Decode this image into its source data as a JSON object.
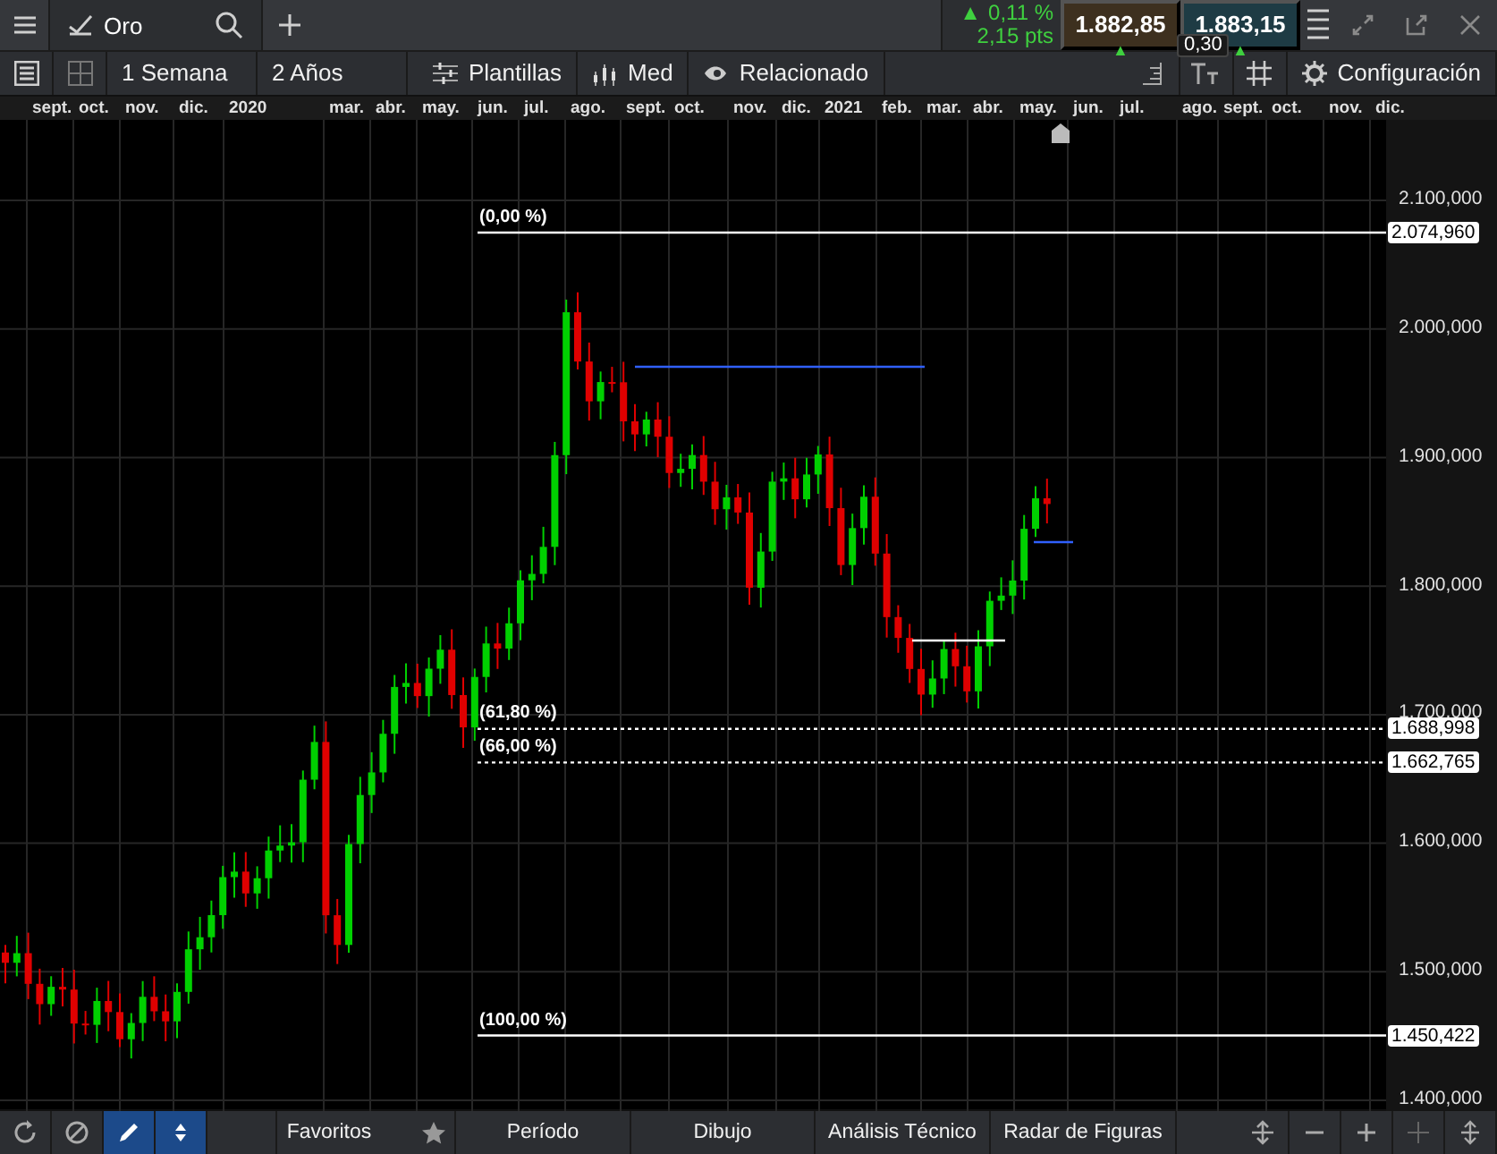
{
  "top_bar": {
    "tab": {
      "title": "Oro"
    },
    "quote": {
      "change_arrow": "▲",
      "change_percent": "0,11 %",
      "change_points": "2,15 pts",
      "bid": "1.882,85",
      "bid_arrow": "▲",
      "ask": "1.883,15",
      "ask_arrow": "▲",
      "spread": "0,30"
    }
  },
  "toolbar": {
    "interval": "1 Semana",
    "range": "2 Años",
    "buttons": [
      {
        "kind": "templates",
        "label": "Plantillas"
      },
      {
        "kind": "indicators",
        "label": "Med"
      },
      {
        "kind": "related",
        "label": "Relacionado"
      }
    ],
    "settings": {
      "label": "Configuración"
    }
  },
  "chart": {
    "time_axis": [
      "sept.",
      "oct.",
      "nov.",
      "dic.",
      "2020",
      "mar.",
      "abr.",
      "may.",
      "jun.",
      "jul.",
      "ago.",
      "sept.",
      "oct.",
      "nov.",
      "dic.",
      "2021",
      "feb.",
      "mar.",
      "abr.",
      "may.",
      "jun.",
      "jul.",
      "ago.",
      "sept.",
      "oct.",
      "nov.",
      "dic."
    ],
    "price_axis": [
      "2.100,000",
      "2.000,000",
      "1.900,000",
      "1.800,000",
      "1.700,000",
      "1.600,000",
      "1.500,000",
      "1.400,000"
    ],
    "fib_levels": [
      {
        "kind": "solid",
        "label": "(0,00 %)",
        "price_tag": "2.074,960"
      },
      {
        "kind": "dotted",
        "label": "(61,80 %)",
        "price_tag": "1.688,998"
      },
      {
        "kind": "dotted",
        "label": "(66,00 %)",
        "price_tag": "1.662,765"
      },
      {
        "kind": "solid",
        "label": "(100,00 %)",
        "price_tag": "1.450,422"
      }
    ]
  },
  "bottom_bar": {
    "tools": [
      {
        "kind": "refresh",
        "selected": false
      },
      {
        "kind": "cancel",
        "selected": false
      },
      {
        "kind": "pencil",
        "selected": true
      },
      {
        "kind": "sort",
        "selected": true
      }
    ],
    "menus": [
      {
        "label": "Favoritos",
        "star": true
      },
      {
        "label": "Período",
        "star": false
      },
      {
        "label": "Dibujo",
        "star": false
      },
      {
        "label": "Análisis Técnico",
        "star": false
      },
      {
        "label": "Radar de Figuras",
        "star": false
      }
    ]
  }
}
